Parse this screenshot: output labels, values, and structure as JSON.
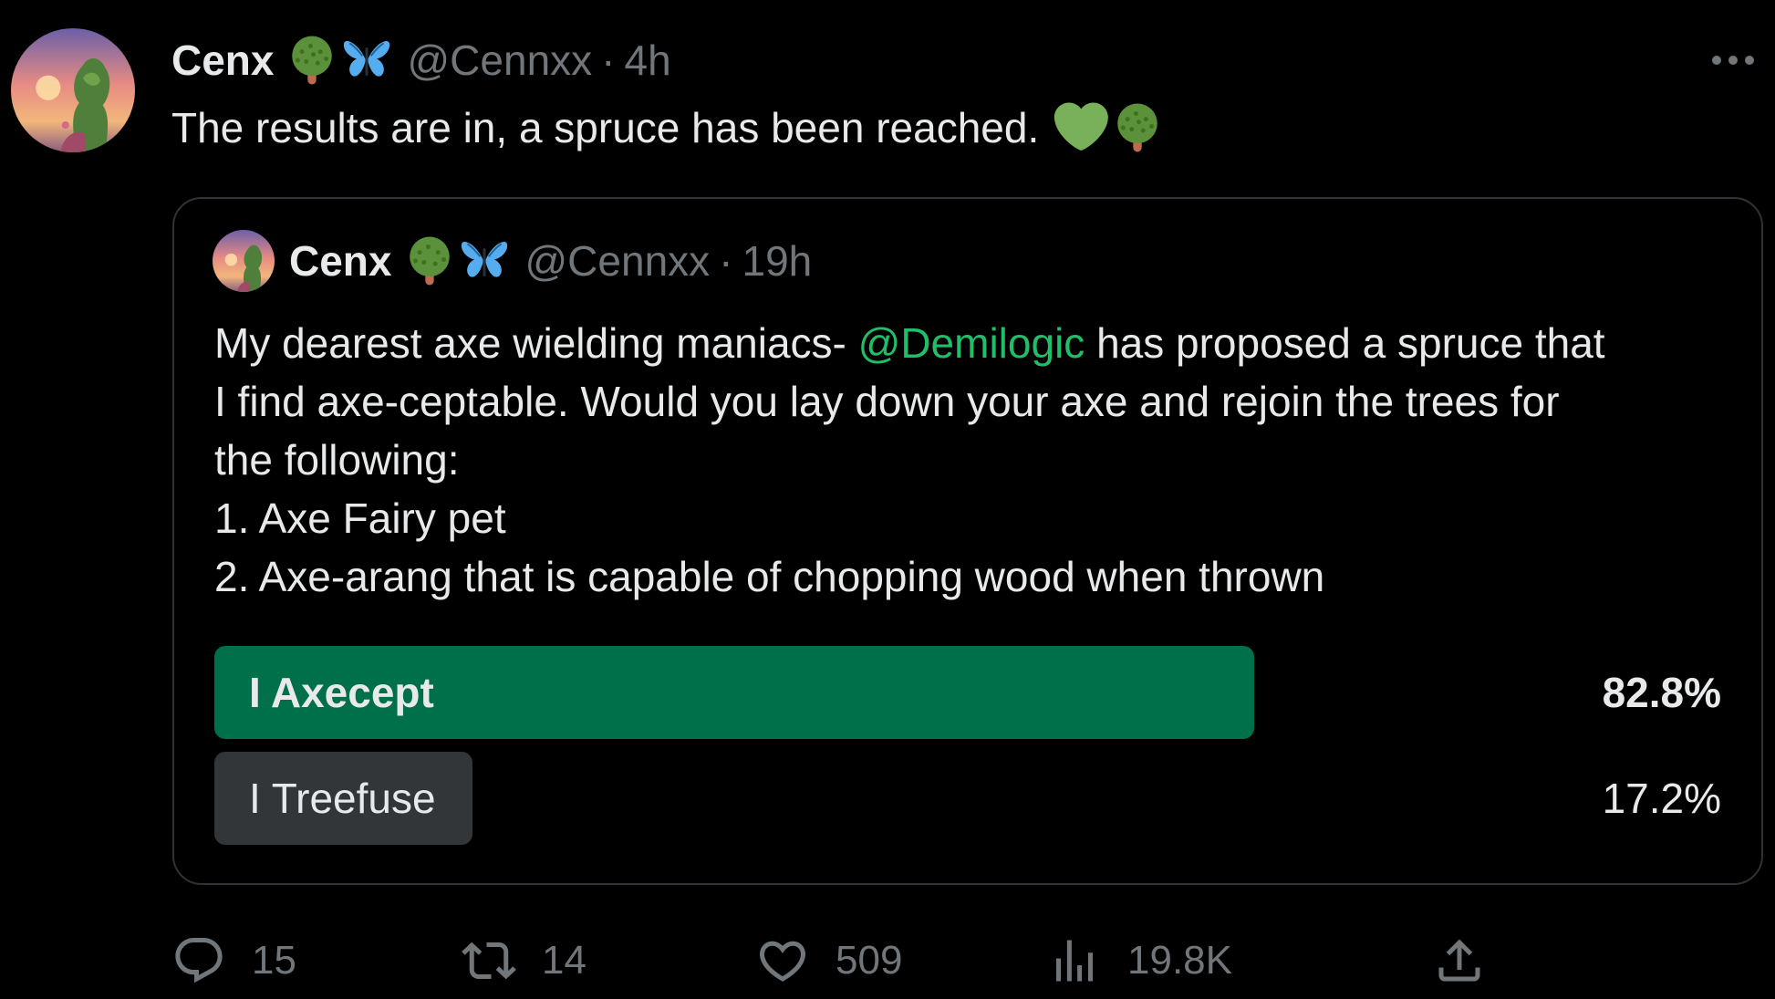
{
  "tweet": {
    "author": {
      "display_name": "Cenx",
      "handle": "@Cennxx",
      "separator": "·",
      "time": "4h",
      "name_emojis": [
        "deciduous-tree",
        "butterfly"
      ]
    },
    "text": "The results are in, a spruce has been reached.",
    "text_emojis": [
      "green-heart",
      "deciduous-tree"
    ],
    "more_label": "More"
  },
  "quote": {
    "author": {
      "display_name": "Cenx",
      "handle": "@Cennxx",
      "separator": "·",
      "time": "19h",
      "name_emojis": [
        "deciduous-tree",
        "butterfly"
      ]
    },
    "text": {
      "line1_before": "My dearest axe wielding maniacs- ",
      "mention": "@Demilogic",
      "line1_after": " has proposed a spruce that",
      "line2": "I find axe-ceptable. Would you lay down your axe and rejoin the trees for",
      "line3": "the following:",
      "line4": "1. Axe Fairy pet",
      "line5": "2. Axe-arang that is capable of chopping wood when thrown"
    },
    "poll": {
      "options": [
        {
          "label": "I Axecept",
          "percent_text": "82.8%",
          "percent": 82.8,
          "winner": true,
          "bar_color": "#00704a"
        },
        {
          "label": "I Treefuse",
          "percent_text": "17.2%",
          "percent": 17.2,
          "winner": false,
          "bar_color": "#333639"
        }
      ]
    }
  },
  "actions": {
    "reply": {
      "icon": "reply-icon",
      "count": "15"
    },
    "retweet": {
      "icon": "retweet-icon",
      "count": "14"
    },
    "like": {
      "icon": "heart-icon",
      "count": "509"
    },
    "views": {
      "icon": "analytics-icon",
      "count": "19.8K"
    },
    "share": {
      "icon": "share-icon"
    }
  },
  "colors": {
    "background": "#000000",
    "text": "#e7e9ea",
    "secondary": "#71767b",
    "border": "#2f3336",
    "mention": "#1fbf6a",
    "poll_winner": "#00704a",
    "poll_other": "#333639"
  }
}
